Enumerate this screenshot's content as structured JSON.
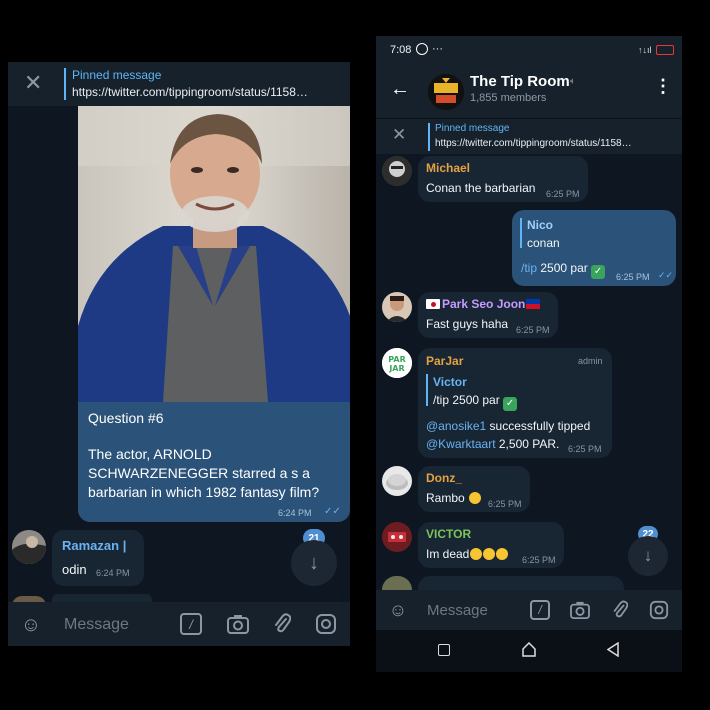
{
  "left": {
    "pinned": {
      "title": "Pinned message",
      "text": "https://twitter.com/tippingroom/status/1158…"
    },
    "question": {
      "line1": "Question #6",
      "line2": "The actor, ARNOLD",
      "line3": "SCHWARZENEGGER starred a s a",
      "line4": "barbarian in which 1982 fantasy film?",
      "time": "6:24 PM"
    },
    "reply": {
      "name": "Ramazan |",
      "text": "odin",
      "time": "6:24 PM"
    },
    "unread_badge": "21",
    "input_placeholder": "Message"
  },
  "right": {
    "status_time": "7:08",
    "status_extra": "···",
    "header": {
      "title": "The Tip Room",
      "members": "1,855 members"
    },
    "pinned": {
      "title": "Pinned message",
      "text": "https://twitter.com/tippingroom/status/1158…"
    },
    "messages": [
      {
        "name": "Michael",
        "text": "Conan the barbarian",
        "time": "6:25 PM"
      },
      {
        "reply_name": "Nico",
        "reply_text": "conan",
        "cmd": "/tip",
        "text": "2500 par",
        "time": "6:25 PM"
      },
      {
        "name": "Park Seo Joon",
        "text": "Fast guys haha",
        "time": "6:25 PM"
      },
      {
        "name": "ParJar",
        "admin": "admin",
        "reply_name": "Victor",
        "reply_text": "/tip 2500 par",
        "mention1": "@anosike1",
        "text1": " successfully tipped",
        "mention2": "@Kwarktaart",
        "text2": " 2,500 PAR.",
        "time": "6:25 PM"
      },
      {
        "name": "Donz_",
        "text": "Rambo",
        "time": "6:25 PM"
      },
      {
        "name": "VICTOR",
        "text": "Im dead",
        "time": "6:25 PM"
      }
    ],
    "unread_badge": "22",
    "input_placeholder": "Message"
  },
  "colors": {
    "accent": "#5eb5f7",
    "background": "#0e1621",
    "bubble_out": "#2b5278",
    "bubble_in": "#182533"
  }
}
